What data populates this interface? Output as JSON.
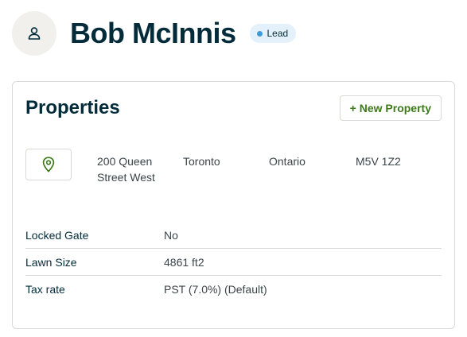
{
  "client": {
    "name": "Bob McInnis",
    "status": "Lead",
    "status_color": "#3d9bd9"
  },
  "properties": {
    "title": "Properties",
    "new_property_label": "+ New Property",
    "address": {
      "street": "200 Queen Street West",
      "city": "Toronto",
      "province": "Ontario",
      "postal_code": "M5V 1Z2"
    },
    "details": [
      {
        "label": "Locked Gate",
        "value": "No"
      },
      {
        "label": "Lawn Size",
        "value": "4861 ft2"
      },
      {
        "label": "Tax rate",
        "value": "PST (7.0%) (Default)"
      }
    ]
  },
  "colors": {
    "heading": "#032b3a",
    "accent_green": "#3d7a1c",
    "border": "#d9d9d6",
    "avatar_bg": "#f1f0ec",
    "badge_bg": "#e5f1fa"
  },
  "icons": {
    "avatar": "person-icon",
    "map": "map-pin-icon"
  }
}
